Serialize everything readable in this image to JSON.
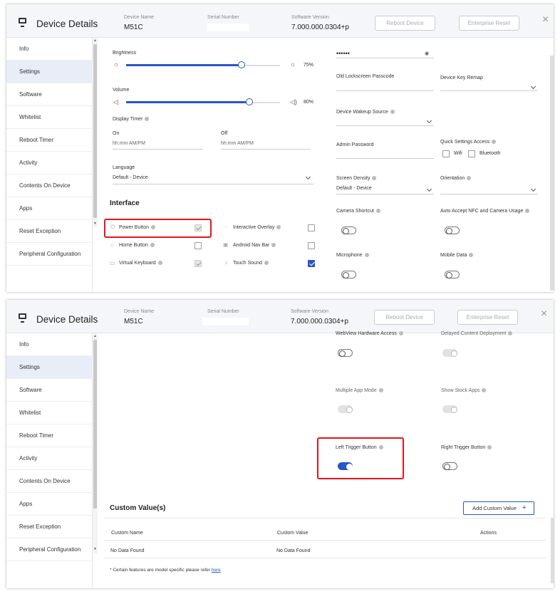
{
  "header": {
    "title": "Device Details",
    "device_name_label": "Device Name",
    "device_name": "M51C",
    "serial_label": "Serial Number",
    "software_label": "Software Version",
    "software_version": "7.000.000.0304+p",
    "reboot_label": "Reboot Device",
    "enterprise_reset_label": "Enterprise Reset",
    "close_glyph": "×"
  },
  "sidebar": {
    "items": [
      {
        "label": "Info"
      },
      {
        "label": "Settings"
      },
      {
        "label": "Software"
      },
      {
        "label": "Whitelist"
      },
      {
        "label": "Reboot Timer"
      },
      {
        "label": "Activity"
      },
      {
        "label": "Contents On Device"
      },
      {
        "label": "Apps"
      },
      {
        "label": "Reset Exception"
      },
      {
        "label": "Peripheral Configuration"
      }
    ],
    "active_index": 1
  },
  "settings": {
    "brightness_label": "Brightness",
    "brightness_value": 75,
    "brightness_pct": "75%",
    "volume_label": "Volume",
    "volume_value": 80,
    "volume_pct": "80%",
    "display_timer_label": "Display Timer",
    "on_label": "On",
    "off_label": "Off",
    "on_placeholder": "hh:mm AM/PM",
    "off_placeholder": "hh:mm AM/PM",
    "language_label": "Language",
    "language_value": "Default - Device",
    "interface_title": "Interface",
    "interface": [
      {
        "label": "Power Button",
        "state": "checked-disabled"
      },
      {
        "label": "Interactive Overlay",
        "state": "unchecked"
      },
      {
        "label": "Home Button",
        "state": "unchecked"
      },
      {
        "label": "Android Nav Bar",
        "state": "unchecked"
      },
      {
        "label": "Virtual Keyboard",
        "state": "checked-disabled"
      },
      {
        "label": "Touch Sound",
        "state": "checked"
      }
    ],
    "password_dots": "••••••",
    "old_passcode_label": "Old Lockscreen Passcode",
    "key_remap_label": "Device Key Remap",
    "wakeup_label": "Device Wakeup Source",
    "admin_password_label": "Admin Password",
    "quick_settings_label": "Quick Settings Access",
    "wifi_label": "Wifi",
    "bluetooth_label": "Bluetooth",
    "screen_density_label": "Screen Density",
    "screen_density_value": "Default - Device",
    "orientation_label": "Orientation",
    "camera_shortcut_label": "Camera Shortcut",
    "auto_accept_label": "Auto Accept NFC and Camera Usage",
    "microphone_label": "Microphone",
    "mobile_data_label": "Mobile Data"
  },
  "settings2": {
    "webview_label": "WebView Hardware Access",
    "delayed_label": "Delayed Content Deployment",
    "multi_app_label": "Multiple App Mode",
    "stock_apps_label": "Show Stock Apps",
    "left_trigger_label": "Left Trigger Button",
    "right_trigger_label": "Right Trigger Button",
    "left_trigger_on": true
  },
  "custom_values": {
    "title": "Custom Value(s)",
    "add_label": "Add Custom Value",
    "add_glyph": "+",
    "columns": [
      "Custom Name",
      "Custom Value",
      "Actions"
    ],
    "empty_name": "No Data Found",
    "empty_value": "No Data Found",
    "footnote_text": "* Certain features are model specific please refer ",
    "footnote_link": "here"
  },
  "colors": {
    "accent": "#2a56c6",
    "highlight": "#e8141a",
    "sidebar_active": "#e8edf7"
  },
  "icons": {
    "sun": "☼",
    "speaker_low": "◁",
    "speaker_high": "◁)",
    "eye": "◉",
    "power": "⏻",
    "home": "⌂",
    "keyboard": "▭",
    "overlay": "◌",
    "nav": "▣",
    "sound": "♪"
  }
}
